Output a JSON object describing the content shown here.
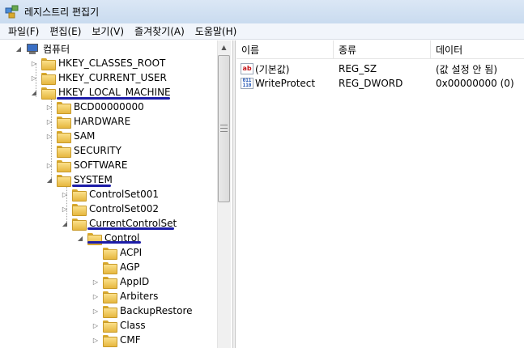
{
  "window": {
    "title": "레지스트리 편집기"
  },
  "menu": [
    "파일(F)",
    "편집(E)",
    "보기(V)",
    "즐겨찾기(A)",
    "도움말(H)"
  ],
  "tree": {
    "root": "컴퓨터",
    "hives": [
      "HKEY_CLASSES_ROOT",
      "HKEY_CURRENT_USER",
      "HKEY_LOCAL_MACHINE"
    ],
    "hklm_children": [
      "BCD00000000",
      "HARDWARE",
      "SAM",
      "SECURITY",
      "SOFTWARE",
      "SYSTEM"
    ],
    "system_children": [
      "ControlSet001",
      "ControlSet002",
      "CurrentControlSet"
    ],
    "ccs_children": [
      "Control"
    ],
    "control_children": [
      "ACPI",
      "AGP",
      "AppID",
      "Arbiters",
      "BackupRestore",
      "Class",
      "CMF"
    ]
  },
  "columns": {
    "name": "이름",
    "type": "종류",
    "data": "데이터"
  },
  "values": [
    {
      "name": "(기본값)",
      "type": "REG_SZ",
      "data": "(값 설정 안 됨)",
      "icon": "string-value-icon",
      "glyph": "ab"
    },
    {
      "name": "WriteProtect",
      "type": "REG_DWORD",
      "data": "0x00000000 (0)",
      "icon": "binary-value-icon",
      "glyph": "011\n110"
    }
  ],
  "colors": {
    "underline": "#1c1ca8",
    "titlebar": "#c9dbef"
  }
}
